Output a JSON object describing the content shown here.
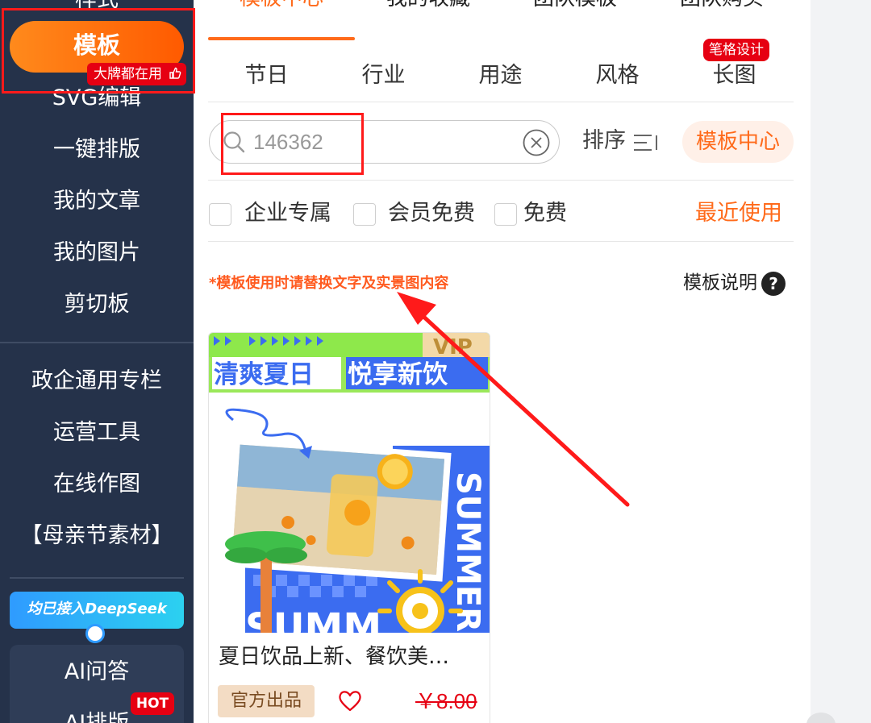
{
  "sidebar": {
    "cut_top_label": "样式",
    "template_pill": {
      "label": "模板",
      "badge": "大牌都在用"
    },
    "items": [
      {
        "label": "SVG编辑"
      },
      {
        "label": "一键排版"
      },
      {
        "label": "我的文章"
      },
      {
        "label": "我的图片"
      },
      {
        "label": "剪切板"
      }
    ],
    "lower_items": [
      {
        "label": "政企通用专栏"
      },
      {
        "label": "运营工具"
      },
      {
        "label": "在线作图"
      },
      {
        "label": "【母亲节素材】"
      }
    ],
    "deepseek_banner": "均已接入DeepSeek",
    "ai": {
      "label": "AI问答",
      "badge": "HOT",
      "next_label": "AI排版"
    }
  },
  "tabs": {
    "top": [
      {
        "label": "模板中心",
        "active": true
      },
      {
        "label": "我的收藏",
        "active": false
      },
      {
        "label": "团队模板",
        "active": false
      },
      {
        "label": "团队购买",
        "active": false
      }
    ],
    "sub": [
      {
        "label": "节日"
      },
      {
        "label": "行业"
      },
      {
        "label": "用途"
      },
      {
        "label": "风格"
      },
      {
        "label": "长图"
      }
    ],
    "sub_badge": "笔格设计"
  },
  "search": {
    "value": "146362",
    "sort_label": "排序",
    "center_button": "模板中心"
  },
  "filters": {
    "options": [
      {
        "label": "企业专属",
        "checked": false
      },
      {
        "label": "会员免费",
        "checked": false
      },
      {
        "label": "免费",
        "checked": false
      }
    ],
    "recent": "最近使用"
  },
  "notice": "*模板使用时请替换文字及实景图内容",
  "explain": {
    "label": "模板说明",
    "icon": "?"
  },
  "card": {
    "banner_left": "清爽夏日",
    "banner_right": "悦享新饮",
    "vip": "VIP",
    "side_text": "SUMMER",
    "bottom_text": "SUMM",
    "title": "夏日饮品上新、餐饮美…",
    "tag": "官方出品",
    "price": "￥8.00"
  },
  "colors": {
    "sidebar_bg": "#25324a",
    "accent": "#ff6a1a",
    "badge_red": "#e60012",
    "annotation_red": "#ff1a1a"
  }
}
